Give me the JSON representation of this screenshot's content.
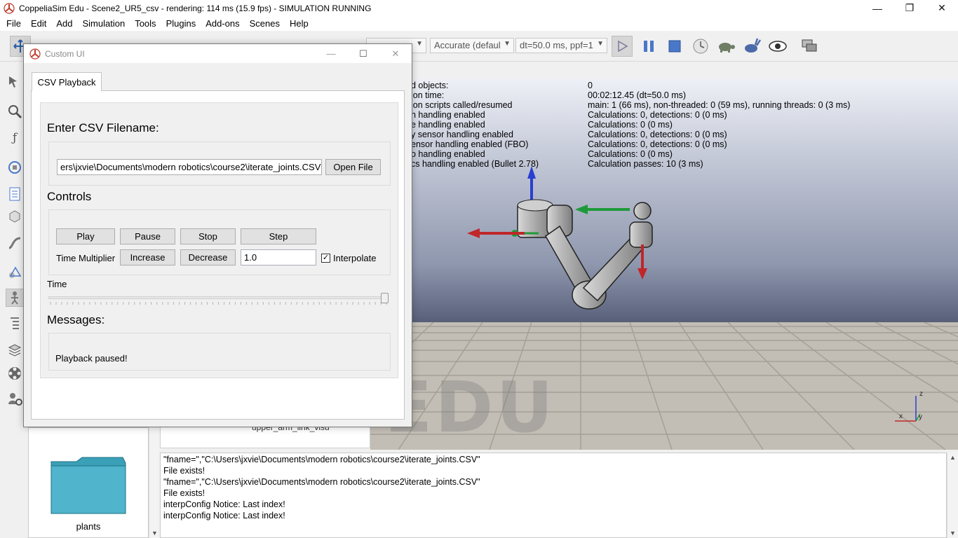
{
  "window": {
    "title": "CoppeliaSim Edu - Scene2_UR5_csv - rendering: 114 ms (15.9 fps) - SIMULATION RUNNING",
    "minimize": "—",
    "maximize": "❐",
    "close": "✕"
  },
  "menu": [
    "File",
    "Edit",
    "Add",
    "Simulation",
    "Tools",
    "Plugins",
    "Add-ons",
    "Scenes",
    "Help"
  ],
  "toolbar": {
    "engine_accuracy": "Accurate (defaul",
    "timestep": "dt=50.0 ms, ppf=1"
  },
  "viewport": {
    "info_rows": [
      {
        "label": "d objects:",
        "value": "0"
      },
      {
        "label": "ion time:",
        "value": "00:02:12.45 (dt=50.0 ms)"
      },
      {
        "label": "ion scripts called/resumed",
        "value": "main: 1 (66 ms), non-threaded: 0 (59 ms), running threads: 0 (3 ms)"
      },
      {
        "label": "n handling enabled",
        "value": "Calculations: 0, detections: 0 (0 ms)"
      },
      {
        "label": "e handling enabled",
        "value": "Calculations: 0 (0 ms)"
      },
      {
        "label": "y sensor handling enabled",
        "value": "Calculations: 0, detections: 0 (0 ms)"
      },
      {
        "label": "ensor handling enabled (FBO)",
        "value": "Calculations: 0, detections: 0 (0 ms)"
      },
      {
        "label": "o handling enabled",
        "value": "Calculations: 0 (0 ms)"
      },
      {
        "label": "cs handling enabled (Bullet 2.78)",
        "value": "Calculation passes: 10 (3 ms)"
      }
    ],
    "watermark": "EDU",
    "axis_labels": {
      "x": "x",
      "y": "y",
      "z": "z"
    }
  },
  "model_browser": {
    "folder_label": "plants"
  },
  "hierarchy": {
    "visible_item": "upper_arm_link_visu"
  },
  "console": {
    "lines": [
      "\"fname=\",\"C:\\Users\\jxvie\\Documents\\modern robotics\\course2\\iterate_joints.CSV\"",
      "File exists!",
      "\"fname=\",\"C:\\Users\\jxvie\\Documents\\modern robotics\\course2\\iterate_joints.CSV\"",
      "File exists!",
      "interpConfig Notice: Last index!",
      "interpConfig Notice: Last index!"
    ]
  },
  "custom_ui": {
    "title": "Custom UI",
    "tab": "CSV Playback",
    "filename_heading": "Enter CSV Filename:",
    "filename_value": "ers\\jxvie\\Documents\\modern robotics\\course2\\iterate_joints.CSV",
    "open_file": "Open File",
    "controls_heading": "Controls",
    "play": "Play",
    "pause": "Pause",
    "stop": "Stop",
    "step": "Step",
    "time_multiplier_label": "Time Multiplier",
    "increase": "Increase",
    "decrease": "Decrease",
    "multiplier_value": "1.0",
    "interpolate_checked": true,
    "interpolate_label": "Interpolate",
    "time_label": "Time",
    "time_slider_fraction": 1.0,
    "messages_heading": "Messages:",
    "message_text": "Playback paused!"
  }
}
